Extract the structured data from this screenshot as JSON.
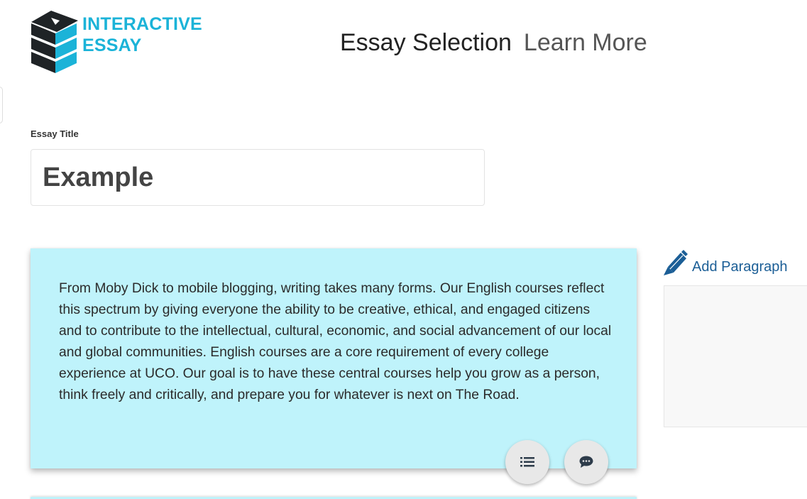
{
  "header": {
    "logo": {
      "line1": "INTERACTIVE",
      "line2": "ESSAY",
      "icon": "stacked-books-logo"
    },
    "nav": [
      {
        "label": "Essay Selection",
        "active": true
      },
      {
        "label": "Learn More",
        "active": false
      }
    ]
  },
  "essay": {
    "title_label": "Essay Title",
    "title_value": "Example"
  },
  "paragraphs": [
    {
      "text": "From Moby Dick to mobile blogging, writing takes many forms. Our English courses reflect this spectrum by giving everyone the ability to be creative, ethical, and engaged citizens and to contribute to the intellectual, cultural, economic, and social advancement of our local and global communities. English courses are a core requirement of every college experience at UCO. Our goal is to have these central courses help you grow as a person, think freely and critically, and prepare you for whatever is next on The Road.",
      "actions": [
        {
          "icon": "list-icon"
        },
        {
          "icon": "comment-icon"
        }
      ]
    }
  ],
  "sidebar": {
    "add_paragraph_label": "Add Paragraph",
    "add_paragraph_icon": "pencil-icon"
  },
  "colors": {
    "brand": "#1bb3d8",
    "paragraph_bg": "#bff3fb",
    "link": "#1b5e96"
  }
}
